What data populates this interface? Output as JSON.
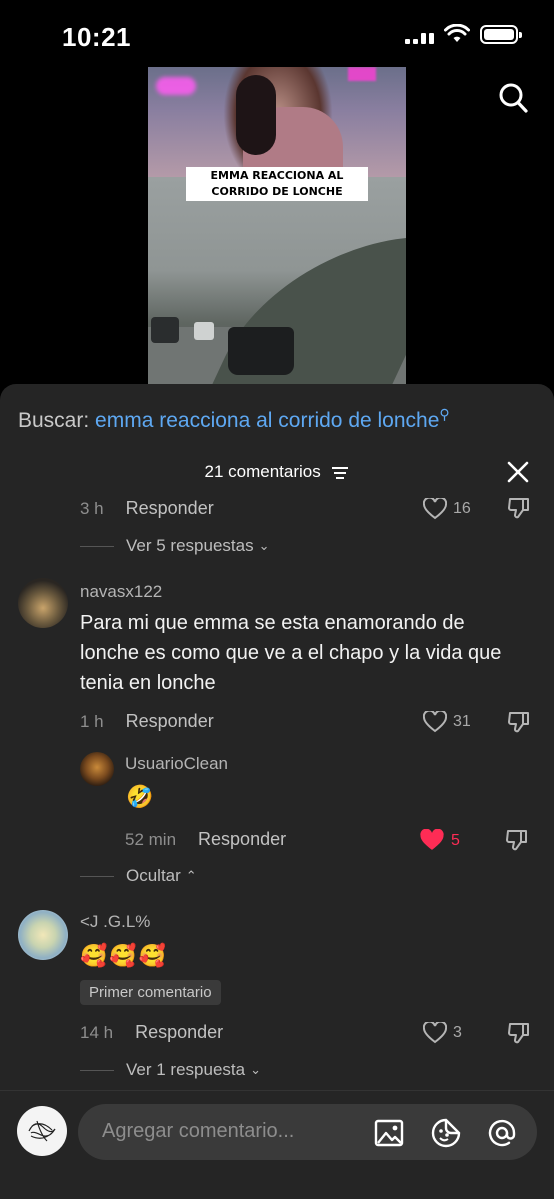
{
  "status_bar": {
    "time": "10:21"
  },
  "video": {
    "caption": "Emma reacciona al corrido de lonche"
  },
  "sheet": {
    "search_prefix": "Buscar:",
    "search_query": "emma reacciona al corrido de lonche",
    "comment_count": "21 comentarios"
  },
  "comments": {
    "top_partial": {
      "time": "3 h",
      "reply": "Responder",
      "likes": "16",
      "view_replies": "Ver 5 respuestas"
    },
    "c1": {
      "username": "navasx122",
      "text": "Para mi que emma se esta enamorando de lonche es como que ve a el chapo y la vida que tenia en lonche",
      "time": "1 h",
      "reply": "Responder",
      "likes": "31",
      "hide": "Ocultar"
    },
    "c1_reply": {
      "username": "UsuarioClean",
      "text": "🤣",
      "time": "52 min",
      "reply": "Responder",
      "likes": "5"
    },
    "c2": {
      "username": "<J .G.L%",
      "text": "🥰🥰🥰",
      "badge": "Primer comentario",
      "time": "14 h",
      "reply": "Responder",
      "likes": "3",
      "view_replies": "Ver 1 respuesta"
    }
  },
  "input": {
    "placeholder": "Agregar comentario..."
  },
  "colors": {
    "accent_link": "#5ea8f2",
    "liked": "#fe2c55",
    "sheet_bg": "#252525"
  }
}
